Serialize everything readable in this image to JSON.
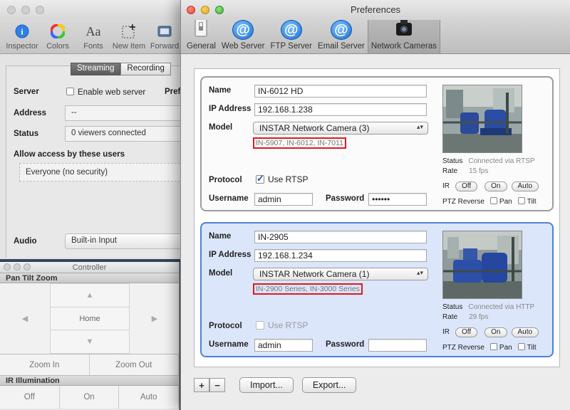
{
  "inspector": {
    "toolbar": [
      {
        "label": "Inspector",
        "icon": "info-icon"
      },
      {
        "label": "Colors",
        "icon": "color-wheel-icon"
      },
      {
        "label": "Fonts",
        "icon": "fonts-icon"
      },
      {
        "label": "New Item",
        "icon": "new-item-icon"
      },
      {
        "label": "Forward",
        "icon": "forward-icon"
      }
    ],
    "tabs": [
      "Streaming",
      "Recording"
    ],
    "server_label": "Server",
    "enable_web_server": "Enable web server",
    "pref_partial": "Pref",
    "address_label": "Address",
    "address_value": "--",
    "status_label": "Status",
    "status_value": "0 viewers connected",
    "allow_label": "Allow access by these users",
    "allow_value": "Everyone (no security)",
    "audio_label": "Audio",
    "audio_value": "Built-in Input"
  },
  "controller": {
    "title": "Controller",
    "ptz_section": "Pan Tilt Zoom",
    "home": "Home",
    "zoom_in": "Zoom In",
    "zoom_out": "Zoom Out",
    "ir_section": "IR Illumination",
    "ir_off": "Off",
    "ir_on": "On",
    "ir_auto": "Auto"
  },
  "prefs": {
    "title": "Preferences",
    "toolbar": [
      {
        "label": "General",
        "icon": "switch-icon"
      },
      {
        "label": "Web Server",
        "icon": "at-icon"
      },
      {
        "label": "FTP Server",
        "icon": "at-icon"
      },
      {
        "label": "Email Server",
        "icon": "at-icon"
      },
      {
        "label": "Network Cameras",
        "icon": "camera-icon"
      }
    ],
    "labels": {
      "name": "Name",
      "ip": "IP Address",
      "model": "Model",
      "protocol": "Protocol",
      "use_rtsp": "Use RTSP",
      "username": "Username",
      "password": "Password",
      "status": "Status",
      "rate": "Rate",
      "ir": "IR",
      "off": "Off",
      "on": "On",
      "auto": "Auto",
      "ptz_reverse": "PTZ Reverse",
      "pan": "Pan",
      "tilt": "Tilt"
    },
    "cameras": [
      {
        "name": "IN-6012 HD",
        "ip": "192.168.1.238",
        "model": "INSTAR Network Camera (3)",
        "models_hint": "IN-5907, IN-6012, IN-7011",
        "use_rtsp": true,
        "username": "admin",
        "password": "••••••",
        "status": "Connected via RTSP",
        "rate": "15 fps"
      },
      {
        "name": "IN-2905",
        "ip": "192.168.1.234",
        "model": "INSTAR Network Camera (1)",
        "models_hint": "IN-2900 Series, IN-3000 Series",
        "use_rtsp": false,
        "username": "admin",
        "password": "",
        "status": "Connected via HTTP",
        "rate": "29 fps"
      }
    ],
    "buttons": {
      "add": "+",
      "remove": "−",
      "import": "Import...",
      "export": "Export..."
    }
  }
}
